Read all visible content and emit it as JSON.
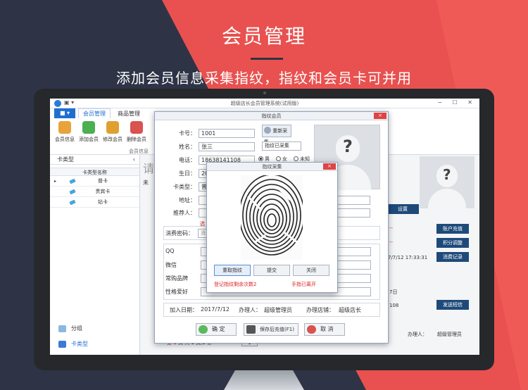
{
  "banner": {
    "title": "会员管理",
    "subtitle": "添加会员信息采集指纹，指纹和会员卡可并用"
  },
  "window": {
    "title": "超级店长会员管理系统(试用版)",
    "quick_access": "▣ ▾",
    "controls": "− ☐ ✕"
  },
  "ribbon": {
    "file_tab": "■ ▾",
    "tabs": [
      "会员管理",
      "商品管理"
    ],
    "buttons": [
      "会员信息",
      "添加会员",
      "修改会员",
      "删除会员"
    ],
    "group_label": "会员信息"
  },
  "left_panel": {
    "header": "卡类型",
    "chevron": "‹",
    "column_header": "卡类型名称",
    "rows": [
      "普卡",
      "贵宾卡",
      "钻卡"
    ],
    "nav": [
      "分组",
      "卡类型"
    ]
  },
  "background": {
    "search_hint": "请",
    "section_hint": "未",
    "settings_button": "设置",
    "red_dash_1": "--",
    "red_dash_2": "--",
    "date_time": "7/7/12 17:33:31",
    "side_buttons": [
      "账户充值",
      "积分调整",
      "消费记录",
      "发送短信"
    ],
    "days_label": "7日",
    "number": "108",
    "operator_label": "办理人：",
    "operator_value": "超级管理员",
    "pager_prefix": "第",
    "pager_page": "1",
    "pager_mid": "页 共 1 页,1 条",
    "pager_box": "1"
  },
  "dialog": {
    "title": "指纹会员",
    "close": "×",
    "labels": {
      "card_no": "卡号：",
      "name": "姓名：",
      "phone": "电话：",
      "birthday": "生日：",
      "card_type": "卡类型：",
      "address": "地址：",
      "referrer": "推荐人：",
      "password": "消费密码：",
      "qq": "QQ",
      "wechat": "微信",
      "brand": "常购品牌",
      "hobby": "性格爱好"
    },
    "values": {
      "card_no": "1001",
      "name": "张三",
      "phone": "18638141108",
      "birthday": "20",
      "card_type": "普",
      "password_hint": "消",
      "referrer_note": "选"
    },
    "gender": [
      "男",
      "女",
      "未知"
    ],
    "recollect_button": "重新采集",
    "fingerprint_status": "指纹已采集",
    "footer": {
      "add_date_label": "加入日期：",
      "add_date": "2017/7/12",
      "operator_label": "办理人：",
      "operator": "超级管理员",
      "store_label": "办理店铺：",
      "store": "超级店长"
    },
    "buttons": [
      "确 定",
      "保存后充值(F1)",
      "取 消"
    ]
  },
  "fingerprint": {
    "title": "指纹采集",
    "close": "×",
    "buttons": [
      "重取指纹",
      "提交",
      "关闭"
    ],
    "remaining_note": "登记指纹剩余次数2",
    "finger_status": "手指已离开"
  },
  "colors": {
    "brand_red": "#e8514f",
    "navy": "#2e3446",
    "ribbon_blue": "#1f6fd0",
    "side_button": "#1e4a7a",
    "alert_red": "#e02020"
  }
}
